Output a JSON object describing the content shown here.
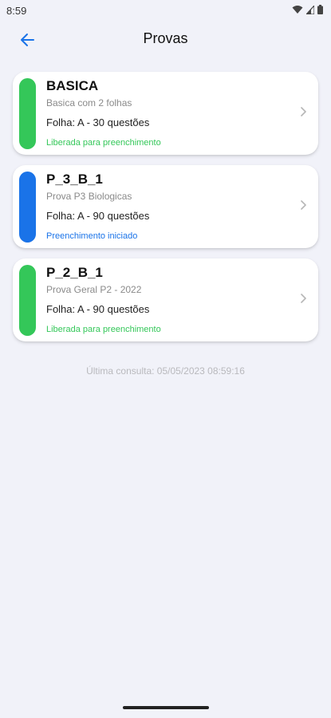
{
  "status_bar": {
    "time": "8:59"
  },
  "header": {
    "title": "Provas"
  },
  "colors": {
    "green": "#34c759",
    "blue": "#1a73e8",
    "green_text": "#34c759",
    "blue_text": "#1a73e8"
  },
  "cards": [
    {
      "title": "BASICA",
      "subtitle": "Basica com 2 folhas",
      "folha": "Folha: A - 30 questões",
      "status": "Liberada para preenchimento",
      "color": "#34c759"
    },
    {
      "title": "P_3_B_1",
      "subtitle": "Prova P3 Biologicas",
      "folha": "Folha: A - 90 questões",
      "status": "Preenchimento iniciado",
      "color": "#1a73e8"
    },
    {
      "title": "P_2_B_1",
      "subtitle": "Prova Geral P2 -  2022",
      "folha": "Folha: A - 90 questões",
      "status": "Liberada para preenchimento",
      "color": "#34c759"
    }
  ],
  "footer": {
    "last_check": "Última consulta: 05/05/2023 08:59:16"
  }
}
